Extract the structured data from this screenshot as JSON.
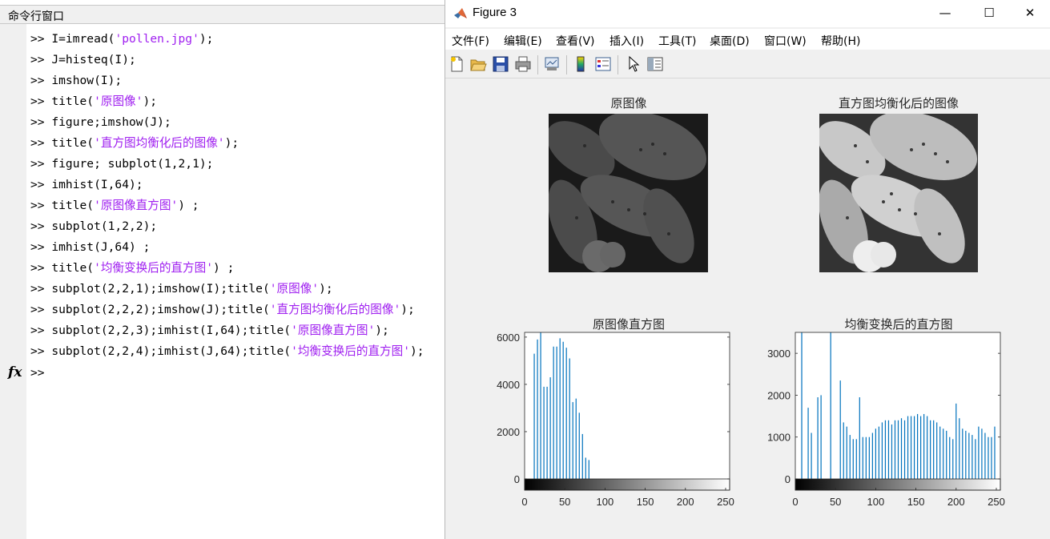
{
  "command_window": {
    "title": "命令行窗口",
    "prompt": ">>",
    "fx_label": "fx",
    "lines": [
      [
        ">> ",
        "I=imread(",
        "'pollen.jpg'",
        ");"
      ],
      [
        ">> ",
        "J=histeq(I);",
        "",
        ""
      ],
      [
        ">> ",
        "imshow(I);",
        "",
        ""
      ],
      [
        ">> ",
        "title(",
        "'原图像'",
        ");"
      ],
      [
        ">> ",
        "figure;imshow(J);",
        "",
        ""
      ],
      [
        ">> ",
        "title(",
        "'直方图均衡化后的图像'",
        ");"
      ],
      [
        ">> ",
        "figure; subplot(1,2,1);",
        "",
        ""
      ],
      [
        ">> ",
        "imhist(I,64);",
        "",
        ""
      ],
      [
        ">> ",
        "title(",
        "'原图像直方图'",
        ") ;"
      ],
      [
        ">> ",
        "subplot(1,2,2);",
        "",
        ""
      ],
      [
        ">> ",
        "imhist(J,64) ;",
        "",
        ""
      ],
      [
        ">> ",
        "title(",
        "'均衡变换后的直方图'",
        ") ;"
      ],
      [
        ">> ",
        "subplot(2,2,1);imshow(I);title(",
        "'原图像'",
        ");"
      ],
      [
        ">> ",
        "subplot(2,2,2);imshow(J);title(",
        "'直方图均衡化后的图像'",
        ");"
      ],
      [
        ">> ",
        "subplot(2,2,3);imhist(I,64);title(",
        "'原图像直方图'",
        ");"
      ],
      [
        ">> ",
        "subplot(2,2,4);imhist(J,64);title(",
        "'均衡变换后的直方图'",
        ");"
      ]
    ],
    "string_color": "#a020f0"
  },
  "figure": {
    "title": "Figure 3",
    "window_buttons": {
      "minimize": "—",
      "maximize": "☐",
      "close": "✕"
    },
    "menus": [
      "文件(F)",
      "编辑(E)",
      "查看(V)",
      "插入(I)",
      "工具(T)",
      "桌面(D)",
      "窗口(W)",
      "帮助(H)"
    ],
    "toolbar_icons": [
      "new-figure-icon",
      "open-file-icon",
      "save-icon",
      "print-icon",
      "link-plot-icon",
      "insert-colorbar-icon",
      "insert-legend-icon",
      "edit-plot-icon",
      "property-inspector-icon"
    ],
    "axes": {
      "img1_title": "原图像",
      "img2_title": "直方图均衡化后的图像",
      "hist1_title": "原图像直方图",
      "hist2_title": "均衡变换后的直方图"
    },
    "bar_color": "#0072bd"
  },
  "chart_data": [
    {
      "type": "bar",
      "title": "原图像直方图",
      "xlim": [
        0,
        255
      ],
      "ylim": [
        0,
        6200
      ],
      "x_ticks": [
        0,
        50,
        100,
        150,
        200,
        250
      ],
      "y_ticks": [
        0,
        2000,
        4000,
        6000
      ],
      "x": [
        12,
        16,
        20,
        24,
        28,
        32,
        36,
        40,
        44,
        48,
        52,
        56,
        60,
        64,
        68,
        72,
        76,
        80
      ],
      "values": [
        5300,
        5900,
        6200,
        3900,
        3900,
        4300,
        5600,
        5600,
        5950,
        5800,
        5550,
        5100,
        3250,
        3400,
        2800,
        1900,
        900,
        800
      ],
      "colorbar": "gray"
    },
    {
      "type": "bar",
      "title": "均衡变换后的直方图",
      "xlim": [
        0,
        255
      ],
      "ylim": [
        0,
        3500
      ],
      "x_ticks": [
        0,
        50,
        100,
        150,
        200,
        250
      ],
      "y_ticks": [
        0,
        1000,
        2000,
        3000
      ],
      "x": [
        8,
        16,
        20,
        28,
        32,
        44,
        56,
        60,
        64,
        68,
        72,
        76,
        80,
        84,
        88,
        92,
        96,
        100,
        104,
        108,
        112,
        116,
        120,
        124,
        128,
        132,
        136,
        140,
        144,
        148,
        152,
        156,
        160,
        164,
        168,
        172,
        176,
        180,
        184,
        188,
        192,
        196,
        200,
        204,
        208,
        212,
        216,
        220,
        224,
        228,
        232,
        236,
        240,
        244,
        248
      ],
      "values": [
        3500,
        1700,
        1100,
        1950,
        2000,
        3500,
        2350,
        1350,
        1250,
        1050,
        950,
        950,
        1950,
        1000,
        1000,
        1000,
        1100,
        1200,
        1250,
        1350,
        1400,
        1400,
        1300,
        1400,
        1400,
        1450,
        1400,
        1500,
        1500,
        1500,
        1550,
        1500,
        1550,
        1500,
        1400,
        1400,
        1350,
        1250,
        1200,
        1150,
        1000,
        950,
        1800,
        1450,
        1200,
        1150,
        1100,
        1050,
        950,
        1250,
        1200,
        1100,
        1000,
        1000,
        1250
      ],
      "colorbar": "gray"
    }
  ]
}
